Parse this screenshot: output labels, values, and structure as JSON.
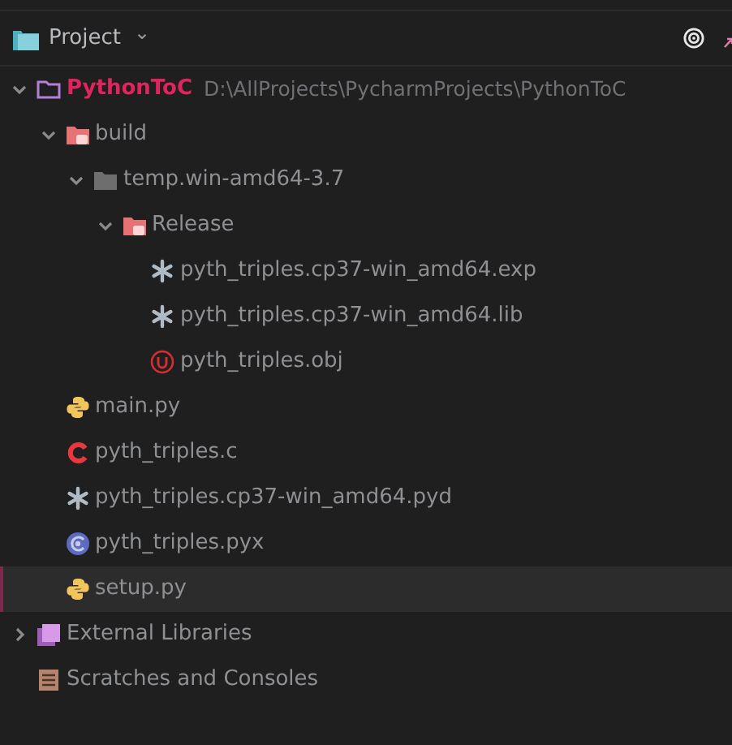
{
  "header": {
    "title": "Project",
    "caret": "⌄"
  },
  "tree": [
    {
      "label": "PythonToC",
      "path": "D:\\AllProjects\\PycharmProjects\\PythonToC",
      "kind": "project",
      "expanded": true,
      "selected": false,
      "children": [
        {
          "label": "build",
          "kind": "excluded-folder",
          "expanded": true,
          "selected": false,
          "children": [
            {
              "label": "temp.win-amd64-3.7",
              "kind": "folder",
              "expanded": true,
              "selected": false,
              "children": [
                {
                  "label": "Release",
                  "kind": "excluded-folder",
                  "expanded": true,
                  "selected": false,
                  "children": [
                    {
                      "label": "pyth_triples.cp37-win_amd64.exp",
                      "kind": "generic",
                      "selected": false
                    },
                    {
                      "label": "pyth_triples.cp37-win_amd64.lib",
                      "kind": "generic",
                      "selected": false
                    },
                    {
                      "label": "pyth_triples.obj",
                      "kind": "object",
                      "selected": false
                    }
                  ]
                }
              ]
            }
          ]
        },
        {
          "label": "main.py",
          "kind": "python",
          "selected": false
        },
        {
          "label": "pyth_triples.c",
          "kind": "c",
          "selected": false
        },
        {
          "label": "pyth_triples.cp37-win_amd64.pyd",
          "kind": "generic",
          "selected": false
        },
        {
          "label": "pyth_triples.pyx",
          "kind": "cython",
          "selected": false
        },
        {
          "label": "setup.py",
          "kind": "python",
          "selected": true
        }
      ]
    },
    {
      "label": "External Libraries",
      "kind": "libraries",
      "expanded": false,
      "selected": false
    },
    {
      "label": "Scratches and Consoles",
      "kind": "scratches",
      "selected": false
    }
  ]
}
